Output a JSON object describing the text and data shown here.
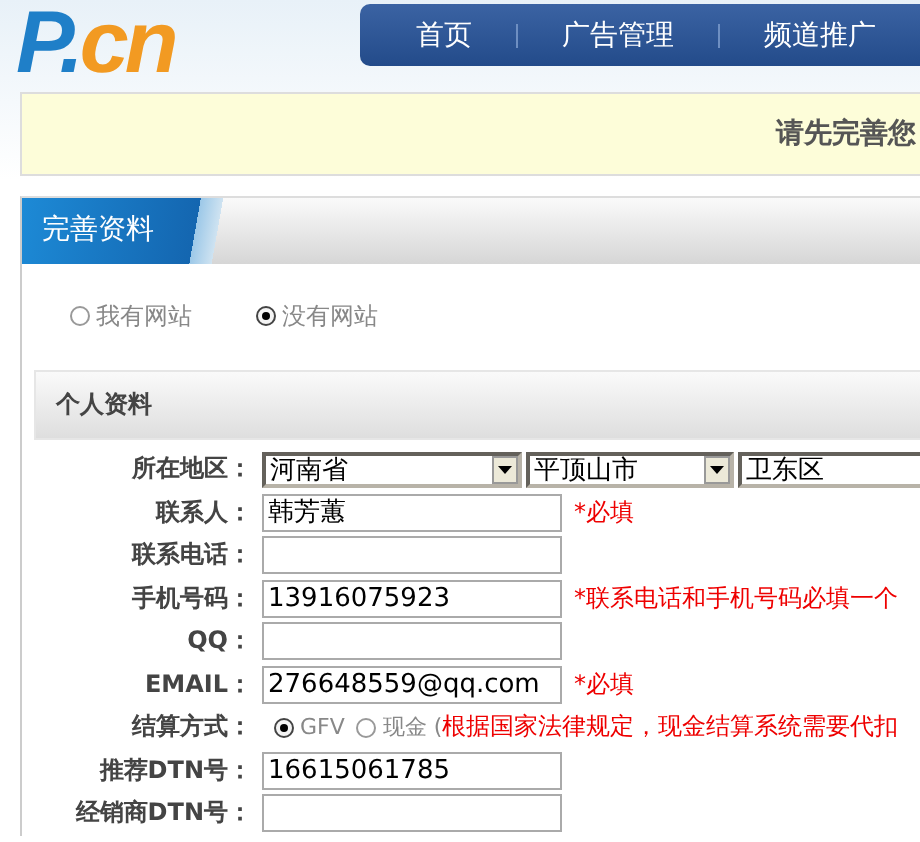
{
  "logo": {
    "first": "P.",
    "second": "cn"
  },
  "nav": [
    {
      "label": "首页"
    },
    {
      "label": "广告管理"
    },
    {
      "label": "频道推广"
    }
  ],
  "notice": "请先完善您",
  "panel_title": "完善资料",
  "site_options": [
    {
      "label": "我有网站",
      "selected": false
    },
    {
      "label": "没有网站",
      "selected": true
    }
  ],
  "section_title": "个人资料",
  "fields": [
    {
      "kind": "selects",
      "label": "所在地区：",
      "selects": [
        "河南省",
        "平顶山市",
        "卫东区"
      ]
    },
    {
      "kind": "text",
      "label": "联系人：",
      "value": "韩芳蕙",
      "note": "*必填"
    },
    {
      "kind": "text",
      "label": "联系电话："
    },
    {
      "kind": "text",
      "label": "手机号码：",
      "value": "13916075923",
      "note": "*联系电话和手机号码必填一个"
    },
    {
      "kind": "text",
      "label": "QQ："
    },
    {
      "kind": "text",
      "label": "EMAIL：",
      "value": "276648559@qq.com",
      "note": "*必填"
    },
    {
      "kind": "radio",
      "label": "结算方式：",
      "options": [
        {
          "label": "GFV",
          "selected": true
        },
        {
          "label": "现金 (",
          "selected": false
        }
      ],
      "note": "根据国家法律规定，现金结算系统需要代扣"
    },
    {
      "kind": "text",
      "label": "推荐DTN号：",
      "value": "16615061785"
    },
    {
      "kind": "text",
      "label": "经销商DTN号："
    }
  ]
}
